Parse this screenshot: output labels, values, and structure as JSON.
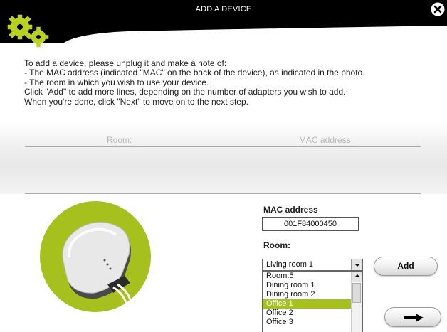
{
  "window": {
    "title": "ADD A DEVICE"
  },
  "intro": {
    "lines": [
      "To add a device, please unplug it and make a note of:",
      "- The MAC address (indicated \"MAC\" on the back of the device), as indicated in the photo.",
      "- The room in which you wish to use your device.",
      "Click \"Add\" to add more lines, depending on the number of adapters you wish to add.",
      "When you're done, click \"Next\" to move on to the next step."
    ]
  },
  "table": {
    "col_room": "Room:",
    "col_mac": "MAC address"
  },
  "form": {
    "mac_label": "MAC address",
    "mac_value": "001F84000450",
    "room_label": "Room:",
    "room_selected": "Living room 1",
    "room_options": [
      "Room:5",
      "Dining room 1",
      "Dining room 2",
      "Office 1",
      "Office 2",
      "Office 3"
    ],
    "room_highlighted": "Office 1",
    "add_label": "Add"
  },
  "icons": {
    "close": "close-icon",
    "gears": "gears-icon",
    "next": "arrow-right-icon",
    "device": "powerline-adapter-image"
  },
  "colors": {
    "accent_green": "#a6c11e",
    "titlebar": "#000000"
  }
}
